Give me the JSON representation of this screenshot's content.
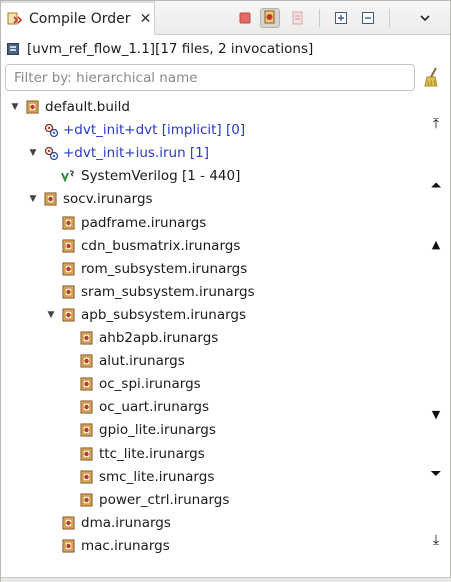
{
  "tab": {
    "title": "Compile Order",
    "close_glyph": "✕"
  },
  "toolbar": {
    "icons": [
      "stop-icon",
      "compile-order-icon",
      "remove-icon",
      "expand-all-icon",
      "collapse-all-icon"
    ]
  },
  "summary": {
    "text": "[uvm_ref_flow_1.1][17 files, 2 invocations]"
  },
  "filter": {
    "placeholder": "Filter by: hierarchical name",
    "value": ""
  },
  "tree": {
    "nodes": [
      {
        "label": "default.build",
        "icon": "build-icon",
        "twisty": "expanded"
      },
      {
        "label": "+dvt_init+dvt [implicit] [0]",
        "icon": "invocation-icon",
        "twisty": "none",
        "color": "#2a3ac4"
      },
      {
        "label": "+dvt_init+ius.irun [1]",
        "icon": "invocation-icon",
        "twisty": "expanded",
        "color": "#2a3ac4"
      },
      {
        "label": "SystemVerilog [1 - 440]",
        "icon": "systemverilog-icon",
        "twisty": "none"
      },
      {
        "label": "socv.irunargs",
        "icon": "args-file-icon",
        "twisty": "expanded"
      },
      {
        "label": "padframe.irunargs",
        "icon": "args-file-icon",
        "twisty": "none"
      },
      {
        "label": "cdn_busmatrix.irunargs",
        "icon": "args-file-icon",
        "twisty": "none"
      },
      {
        "label": "rom_subsystem.irunargs",
        "icon": "args-file-icon",
        "twisty": "none"
      },
      {
        "label": "sram_subsystem.irunargs",
        "icon": "args-file-icon",
        "twisty": "none"
      },
      {
        "label": "apb_subsystem.irunargs",
        "icon": "args-file-icon",
        "twisty": "expanded"
      },
      {
        "label": "ahb2apb.irunargs",
        "icon": "args-file-icon",
        "twisty": "none"
      },
      {
        "label": "alut.irunargs",
        "icon": "args-file-icon",
        "twisty": "none"
      },
      {
        "label": "oc_spi.irunargs",
        "icon": "args-file-icon",
        "twisty": "none"
      },
      {
        "label": "oc_uart.irunargs",
        "icon": "args-file-icon",
        "twisty": "none"
      },
      {
        "label": "gpio_lite.irunargs",
        "icon": "args-file-icon",
        "twisty": "none"
      },
      {
        "label": "ttc_lite.irunargs",
        "icon": "args-file-icon",
        "twisty": "none"
      },
      {
        "label": "smc_lite.irunargs",
        "icon": "args-file-icon",
        "twisty": "none"
      },
      {
        "label": "power_ctrl.irunargs",
        "icon": "args-file-icon",
        "twisty": "none"
      },
      {
        "label": "dma.irunargs",
        "icon": "args-file-icon",
        "twisty": "none"
      },
      {
        "label": "mac.irunargs",
        "icon": "args-file-icon",
        "twisty": "none"
      }
    ]
  },
  "nav": {
    "buttons": [
      {
        "name": "go-to-top-button",
        "glyph": "⤒"
      },
      {
        "name": "page-up-button",
        "glyph": "⏶"
      },
      {
        "name": "step-up-button",
        "glyph": "▲"
      },
      {
        "name": "step-down-button",
        "glyph": "▼"
      },
      {
        "name": "page-down-button",
        "glyph": "⏷"
      },
      {
        "name": "go-to-bottom-button",
        "glyph": "⤓"
      }
    ]
  },
  "colors": {
    "link_blue": "#2a3ac4",
    "stop_red": "#d9534f",
    "icon_orange": "#e8a33a",
    "icon_brown": "#7a4a1f"
  }
}
